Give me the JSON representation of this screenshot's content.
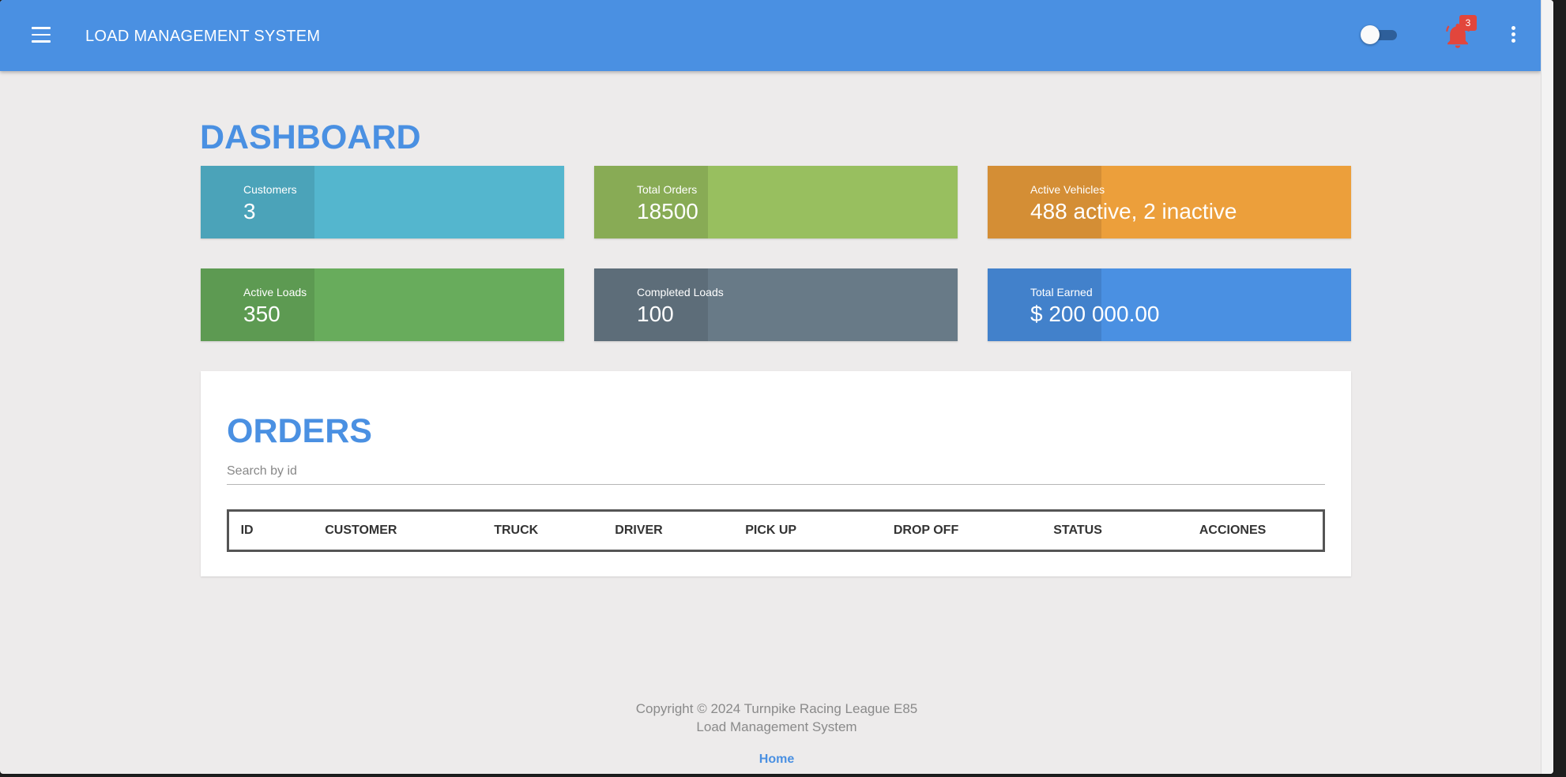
{
  "appbar": {
    "title": "LOAD MANAGEMENT SYSTEM",
    "notifications_count": "3",
    "icons": {
      "menu": "hamburger-menu-icon",
      "toggle": "theme-toggle",
      "bell": "bell-icon",
      "more": "more-vert-icon"
    }
  },
  "dashboard": {
    "title": "DASHBOARD",
    "cards": [
      {
        "label": "Customers",
        "value": "3",
        "color": "#54b6ce"
      },
      {
        "label": "Total Orders",
        "value": "18500",
        "color": "#98bf5f"
      },
      {
        "label": "Active Vehicles",
        "value": "488 active, 2 inactive",
        "color": "#ec9f3b"
      },
      {
        "label": "Active Loads",
        "value": "350",
        "color": "#68ac5c"
      },
      {
        "label": "Completed Loads",
        "value": "100",
        "color": "#687a87"
      },
      {
        "label": "Total Earned",
        "value": "$ 200 000.00",
        "color": "#4a90e2"
      }
    ]
  },
  "orders": {
    "title": "ORDERS",
    "search_placeholder": "Search by id",
    "columns": [
      "ID",
      "CUSTOMER",
      "TRUCK",
      "DRIVER",
      "PICK UP",
      "DROP OFF",
      "STATUS",
      "ACCIONES"
    ]
  },
  "footer": {
    "copyright_line1": "Copyright © 2024 Turnpike Racing League E85",
    "copyright_line2": "Load Management System",
    "home_link": "Home"
  },
  "colors": {
    "primary": "#4a90e2",
    "background": "#edebeb",
    "badge": "#e2463c",
    "bell": "#e2463c"
  }
}
